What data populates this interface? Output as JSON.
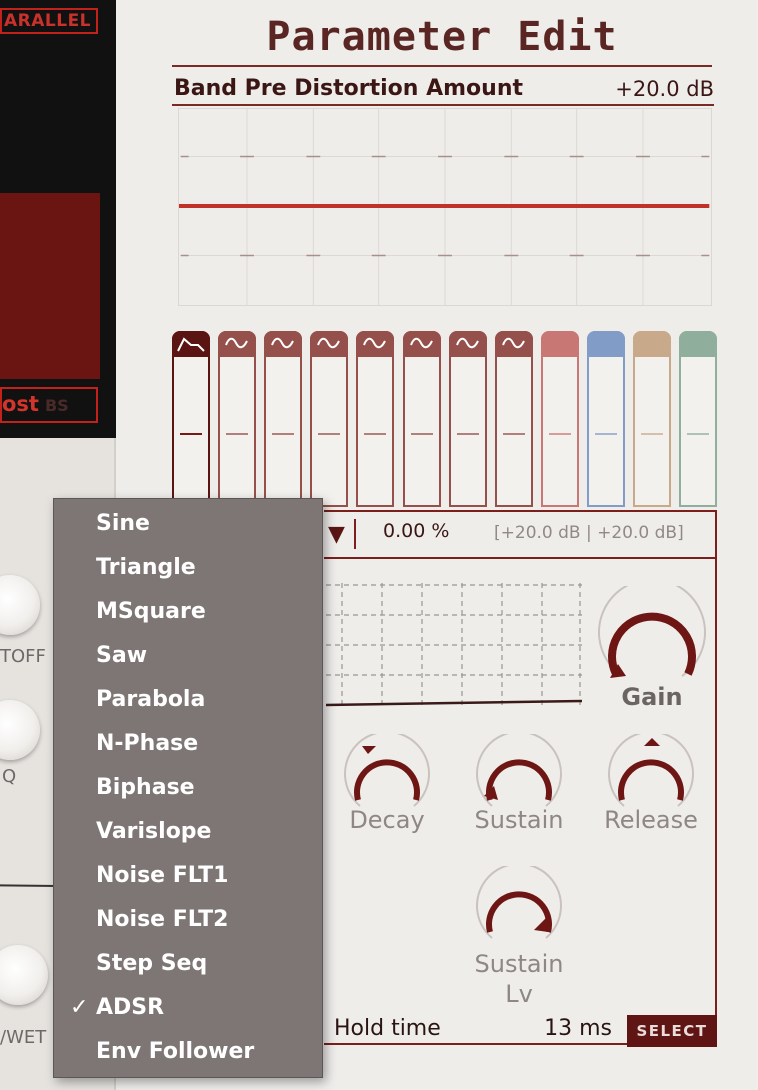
{
  "left": {
    "mode_tag": "ARALLEL",
    "boost_on": "ost",
    "boost_off": "BS",
    "cutoff_label": "TOFF",
    "q_label": "Q",
    "drywet_label": "/WET"
  },
  "header": {
    "title": "Parameter Edit",
    "param_name": "Band Pre Distortion Amount",
    "param_value": "+20.0 dB"
  },
  "bands": [
    {
      "icon": "adsr-icon",
      "color": "#5a1513"
    },
    {
      "icon": "sine-icon",
      "color": "#96504b"
    },
    {
      "icon": "sine-icon",
      "color": "#96504b"
    },
    {
      "icon": "sine-icon",
      "color": "#96504b"
    },
    {
      "icon": "sine-icon",
      "color": "#96504b"
    },
    {
      "icon": "sine-icon",
      "color": "#96504b"
    },
    {
      "icon": "sine-icon",
      "color": "#96504b"
    },
    {
      "icon": "sine-icon",
      "color": "#96504b"
    },
    {
      "icon": "none",
      "color": "#c97775"
    },
    {
      "icon": "none",
      "color": "#819cc7"
    },
    {
      "icon": "none",
      "color": "#c8a989"
    },
    {
      "icon": "none",
      "color": "#8fae9c"
    }
  ],
  "mod": {
    "percent": "0.00 %",
    "range": "[+20.0 dB | +20.0 dB]",
    "knobs": {
      "gain": "Gain",
      "decay": "Decay",
      "sustain": "Sustain",
      "release": "Release",
      "sustain_lv_1": "Sustain",
      "sustain_lv_2": "Lv"
    },
    "hold_label": "Hold time",
    "hold_value": "13 ms",
    "select_label": "SELECT"
  },
  "menu": {
    "checked": "ADSR",
    "items": [
      "Sine",
      "Triangle",
      "MSquare",
      "Saw",
      "Parabola",
      "N-Phase",
      "Biphase",
      "Varislope",
      "Noise FLT1",
      "Noise FLT2",
      "Step Seq",
      "ADSR",
      "Env Follower"
    ]
  },
  "colors": {
    "accent": "#7b1f1c",
    "curve": "#c0312a",
    "menu_bg": "#7d7674"
  }
}
